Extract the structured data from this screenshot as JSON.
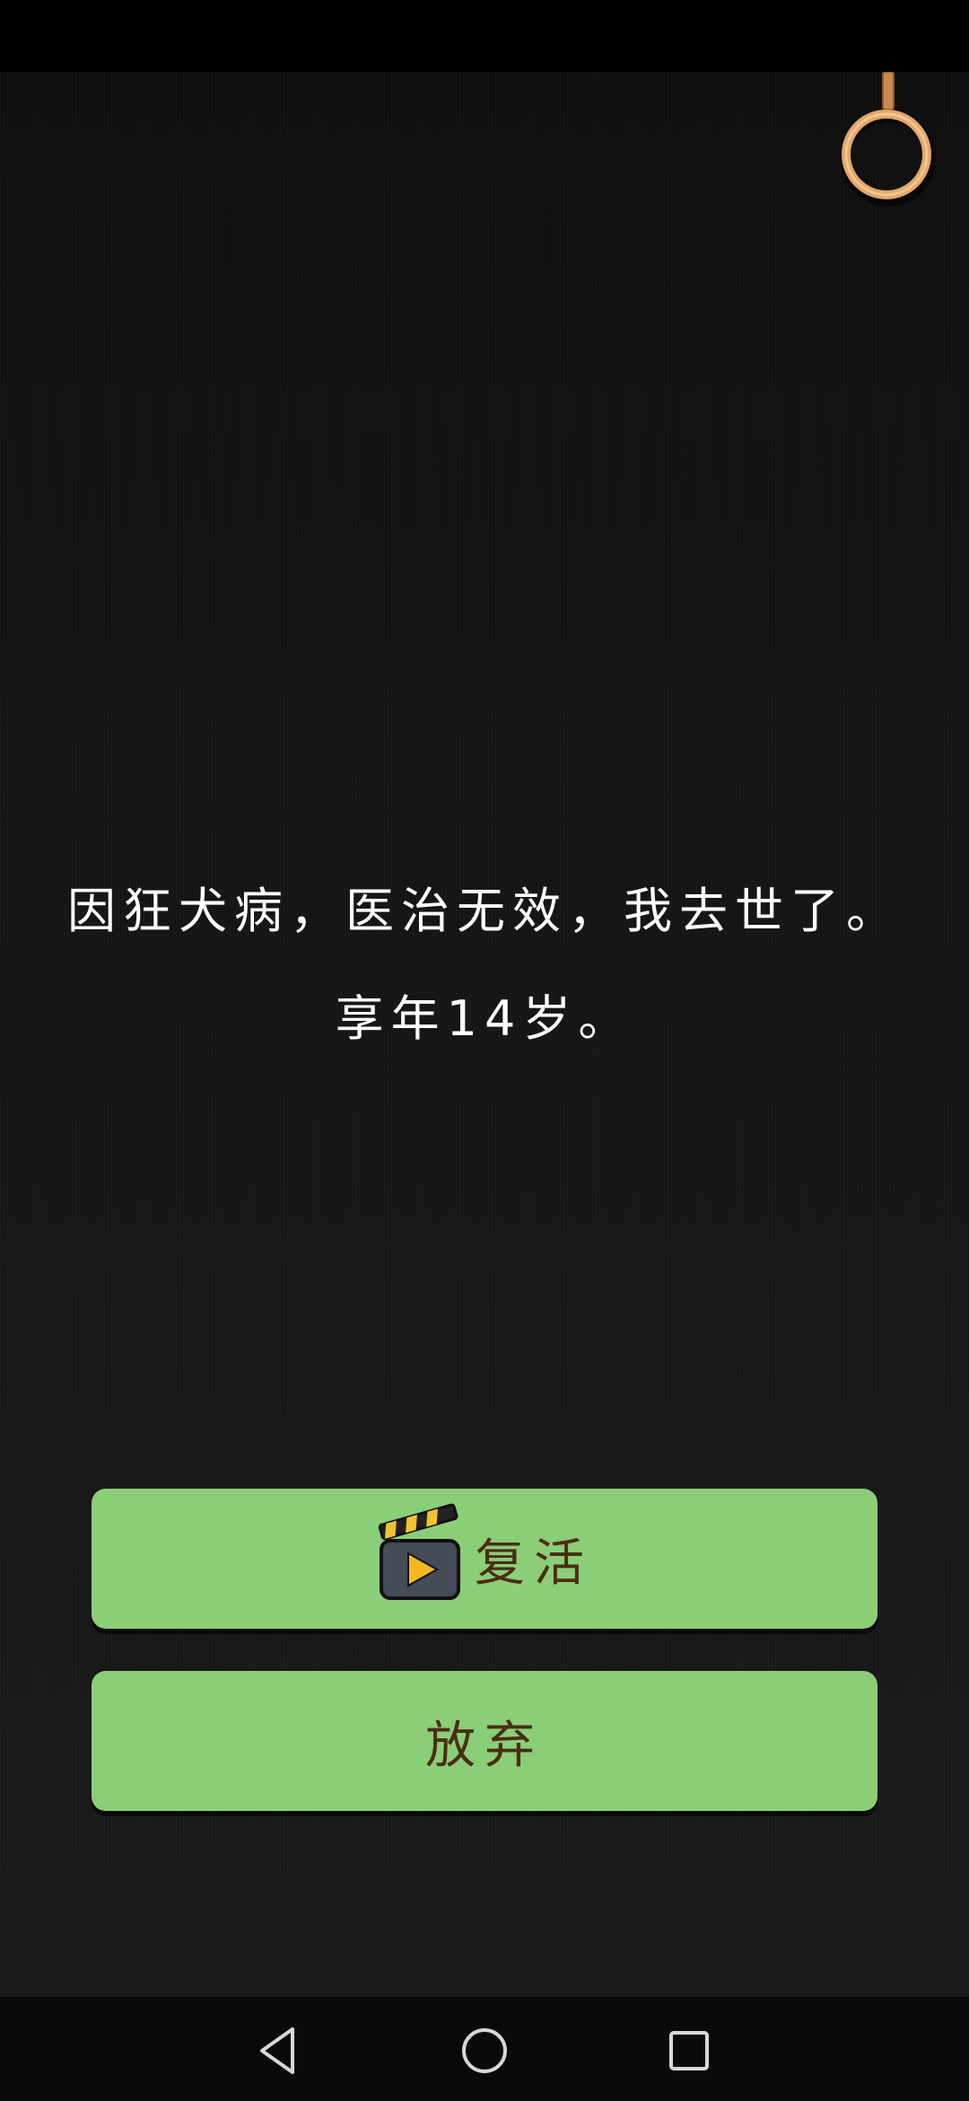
{
  "message": {
    "line1": "因狂犬病，医治无效，我去世了。",
    "line2": "享年14岁。"
  },
  "buttons": {
    "revive_label": "复活",
    "revive_icon": "video-clapperboard-play-icon",
    "giveup_label": "放弃"
  },
  "nav_bar": {
    "back_icon": "triangle-back-icon",
    "home_icon": "circle-home-icon",
    "recent_icon": "square-recent-apps-icon"
  },
  "colors": {
    "button_green": "#8bce78",
    "button_text": "#4a2e12",
    "ring": "#e2a86a",
    "background": "#161616"
  }
}
